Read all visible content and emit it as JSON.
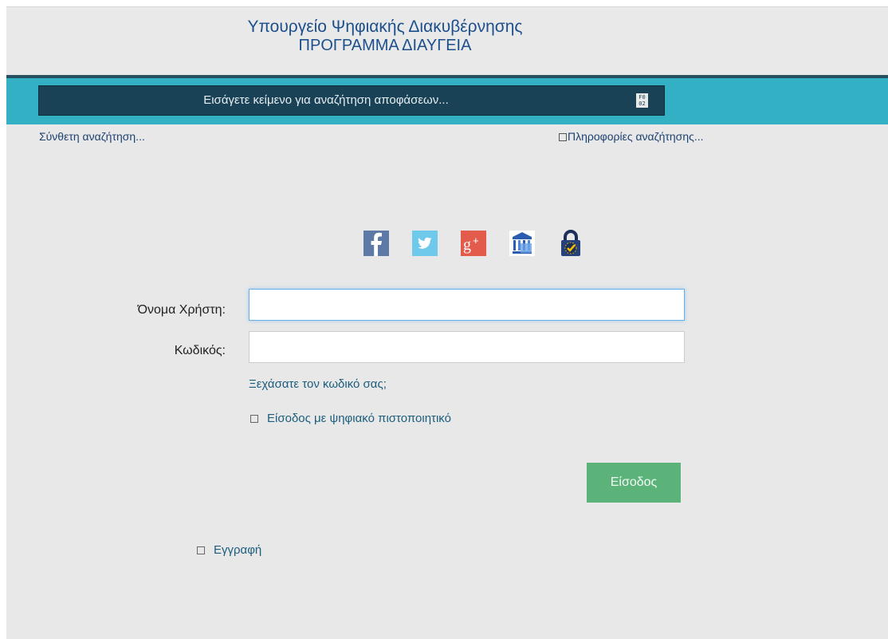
{
  "header": {
    "title": "Υπουργείο Ψηφιακής Διακυβέρνησης",
    "subtitle": "ΠΡΟΓΡΑΜΜΑ ΔΙΑΥΓΕΙΑ"
  },
  "search": {
    "placeholder": "Εισάγετε κείμενο για αναζήτηση αποφάσεων...",
    "icon_text": "F0 02"
  },
  "links": {
    "advanced_search": "Σύνθετη αναζήτηση...",
    "search_info": "Πληροφορίες αναζήτησης..."
  },
  "social": {
    "items": [
      {
        "name": "facebook",
        "label": "f",
        "color": "#5d7aa6"
      },
      {
        "name": "twitter",
        "label": "t",
        "color": "#6ec9ea"
      },
      {
        "name": "google-plus",
        "label": "g+",
        "color": "#e35b4b"
      },
      {
        "name": "taxisnet",
        "label": "",
        "color": "#2a5db0"
      },
      {
        "name": "secure-login",
        "label": "",
        "color": "#28407a"
      }
    ]
  },
  "form": {
    "username_label": "Όνομα Χρήστη:",
    "username_value": "",
    "password_label": "Κωδικός:",
    "password_value": "",
    "forgot_password": "Ξεχάσατε τον κωδικό σας;",
    "certificate_login": "Είσοδος με ψηφιακό πιστοποιητικό",
    "login_button": "Είσοδος",
    "register": "Εγγραφή"
  },
  "colors": {
    "page_background": "#e8e8e8",
    "search_band": "#33b0c4",
    "search_box": "#1a4256",
    "header_text": "#1c4f8c",
    "link_text": "#1c5d7c",
    "login_button": "#5bb37a"
  }
}
